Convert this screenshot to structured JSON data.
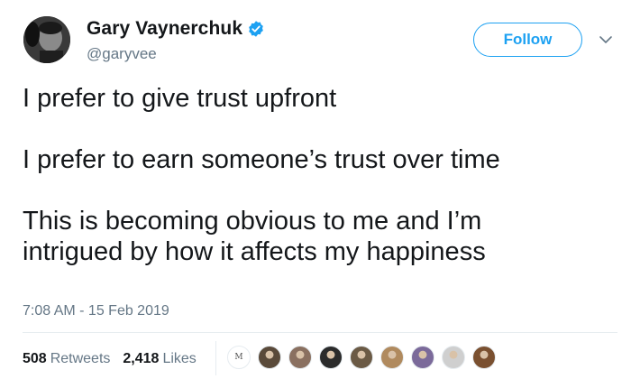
{
  "user": {
    "display_name": "Gary Vaynerchuk",
    "handle": "@garyvee",
    "verified": true
  },
  "actions": {
    "follow_label": "Follow",
    "menu_icon": "chevron-down-icon"
  },
  "tweet": {
    "paragraphs": [
      "I prefer to give trust upfront",
      "I prefer to earn someone’s trust over time",
      "This is becoming obvious to me and I’m\nintrigued by how it affects my happiness"
    ],
    "timestamp": "7:08 AM - 15 Feb 2019"
  },
  "stats": {
    "retweets_count": "508",
    "retweets_label": "Retweets",
    "likes_count": "2,418",
    "likes_label": "Likes"
  },
  "likers": {
    "logo_text": "M",
    "avatar_colors": [
      "#5a4a3a",
      "#8a7060",
      "#2b2b2b",
      "#6b5a45",
      "#b08a5e",
      "#7b6a9a",
      "#cfcfcf",
      "#7a5030"
    ]
  },
  "colors": {
    "accent": "#1da1f2",
    "text_primary": "#14171a",
    "text_secondary": "#657786"
  }
}
